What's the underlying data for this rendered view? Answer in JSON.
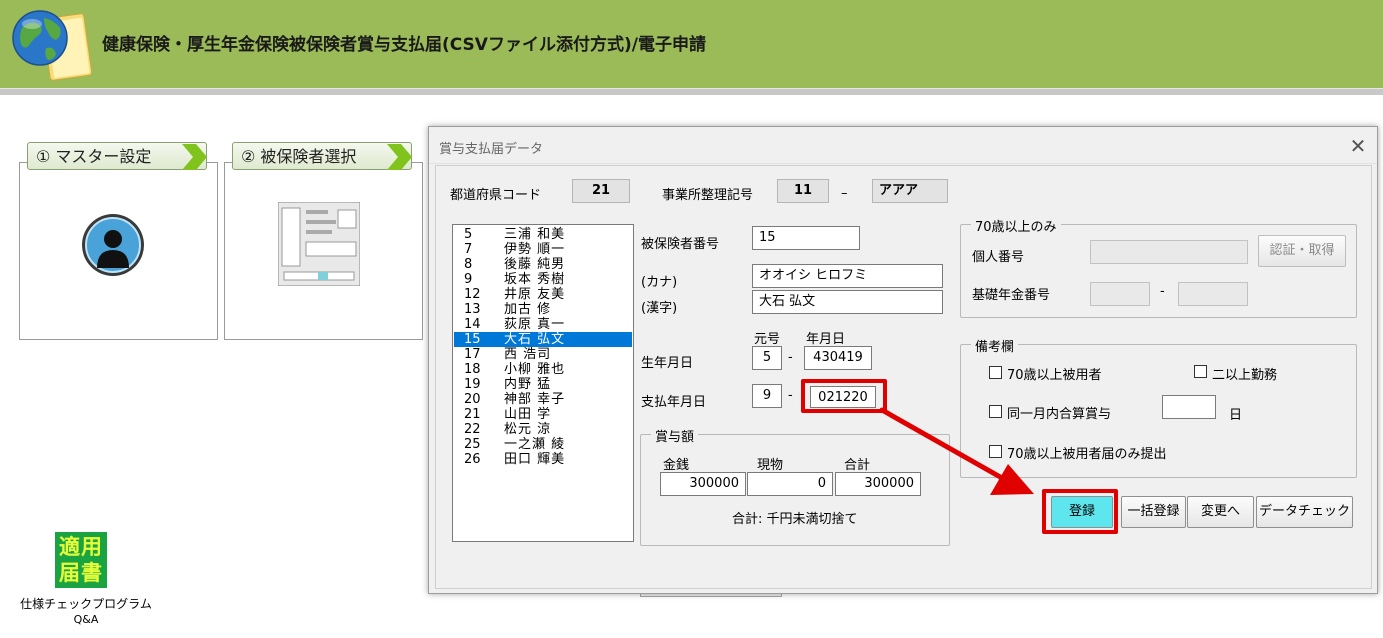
{
  "header": {
    "title": "健康保険・厚生年金保険被保険者賞与支払届(CSVファイル添付方式)/電子申請",
    "bg_color": "#9bbb59"
  },
  "steps": [
    {
      "label": "① マスター設定"
    },
    {
      "label": "② 被保険者選択"
    }
  ],
  "shortcut": {
    "icon_text_1": "適用",
    "icon_text_2": "届書",
    "line1": "仕様チェックプログラム",
    "line2": "Q&A"
  },
  "dialog": {
    "title": "賞与支払届データ",
    "pref_label": "都道府県コード",
    "pref_value": "21",
    "office_label": "事業所整理記号",
    "office_code": "11",
    "office_dash": "–",
    "office_name": "アアア",
    "list": [
      {
        "num": "5",
        "name": "三浦 和美"
      },
      {
        "num": "7",
        "name": "伊勢 順一"
      },
      {
        "num": "8",
        "name": "後藤 純男"
      },
      {
        "num": "9",
        "name": "坂本 秀樹"
      },
      {
        "num": "12",
        "name": "井原 友美"
      },
      {
        "num": "13",
        "name": "加古 修"
      },
      {
        "num": "14",
        "name": "荻原 真一"
      },
      {
        "num": "15",
        "name": "大石 弘文"
      },
      {
        "num": "17",
        "name": "西 浩司"
      },
      {
        "num": "18",
        "name": "小柳 雅也"
      },
      {
        "num": "19",
        "name": "内野 猛"
      },
      {
        "num": "20",
        "name": "神部 幸子"
      },
      {
        "num": "21",
        "name": "山田 学"
      },
      {
        "num": "22",
        "name": "松元 涼"
      },
      {
        "num": "25",
        "name": "一之瀬 綾"
      },
      {
        "num": "26",
        "name": "田口 輝美"
      }
    ],
    "selected_num": "15",
    "insured_no_label": "被保険者番号",
    "insured_no": "15",
    "kana_label": "(カナ)",
    "kana_value": "オオイシ ヒロフミ",
    "kanji_label": "(漢字)",
    "kanji_value": "大石 弘文",
    "era_header": "元号",
    "ymd_header": "年月日",
    "dash": "-",
    "birth_label": "生年月日",
    "birth_era": "5",
    "birth_date": "430419",
    "pay_label": "支払年月日",
    "pay_era": "9",
    "pay_date": "021220",
    "bonus_group": "賞与額",
    "cash_label": "金銭",
    "kind_label": "現物",
    "total_label": "合計",
    "cash_value": "300000",
    "kind_value": "0",
    "total_value": "300000",
    "bonus_note": "合計: 千円未満切捨て",
    "over70_group": "70歳以上のみ",
    "personal_no_label": "個人番号",
    "auth_button": "認証・取得",
    "pension_no_label": "基礎年金番号",
    "pension_dash": "-",
    "remarks_group": "備考欄",
    "chk_over70": "70歳以上被用者",
    "chk_multi": "二以上勤務",
    "chk_same_month": "同一月内合算賞与",
    "day_unit": "日",
    "chk_over70_only": "70歳以上被用者届のみ提出",
    "btn_register": "登録",
    "btn_bulk": "一括登録",
    "btn_change": "変更へ",
    "btn_check": "データチェック",
    "register_color": "#5ee6ee",
    "highlight_color": "#e00000"
  }
}
